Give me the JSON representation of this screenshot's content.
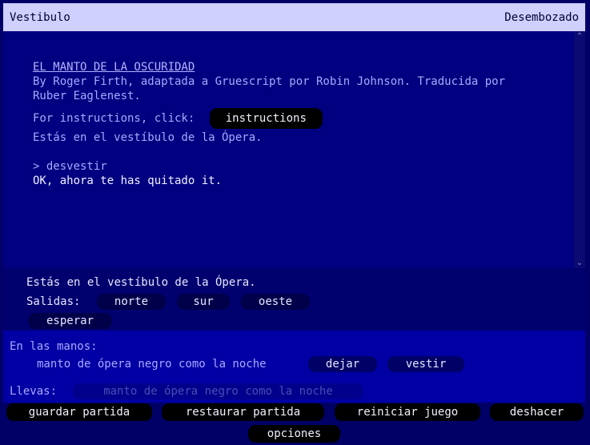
{
  "status": {
    "location": "Vestibulo",
    "state": "Desembozado"
  },
  "story": {
    "title": "EL MANTO DE LA OSCURIDAD",
    "credits": "By Roger Firth, adaptada a Gruescript por Robin Johnson. Traducida por Ruber Eaglenest.",
    "instructions_prompt": "For instructions, click:",
    "instructions_button": "instructions",
    "intro": "Estás en el vestíbulo de la Ópera.",
    "command": "> desvestir",
    "response": "OK, ahora te has quitado it."
  },
  "room": {
    "description": "Estás en el vestíbulo de la Ópera.",
    "exits_label": "Salidas:",
    "exits": [
      "norte",
      "sur",
      "oeste"
    ],
    "wait_button": "esperar"
  },
  "inventory": {
    "held_label": "En las manos:",
    "held_item": "manto de ópera negro como la noche",
    "held_actions": [
      "dejar",
      "vestir"
    ],
    "worn_label": "Llevas:",
    "worn_item": "manto de ópera negro como la noche"
  },
  "menu": {
    "save": "guardar partida",
    "restore": "restaurar partida",
    "restart": "reiniciar juego",
    "undo": "deshacer",
    "options": "opciones"
  },
  "colors": {
    "background": "#000066",
    "status_bar": "#d0d0ff",
    "story_bg": "#000080",
    "inventory_bg": "#0000a4",
    "text": "#a8a8ff"
  }
}
